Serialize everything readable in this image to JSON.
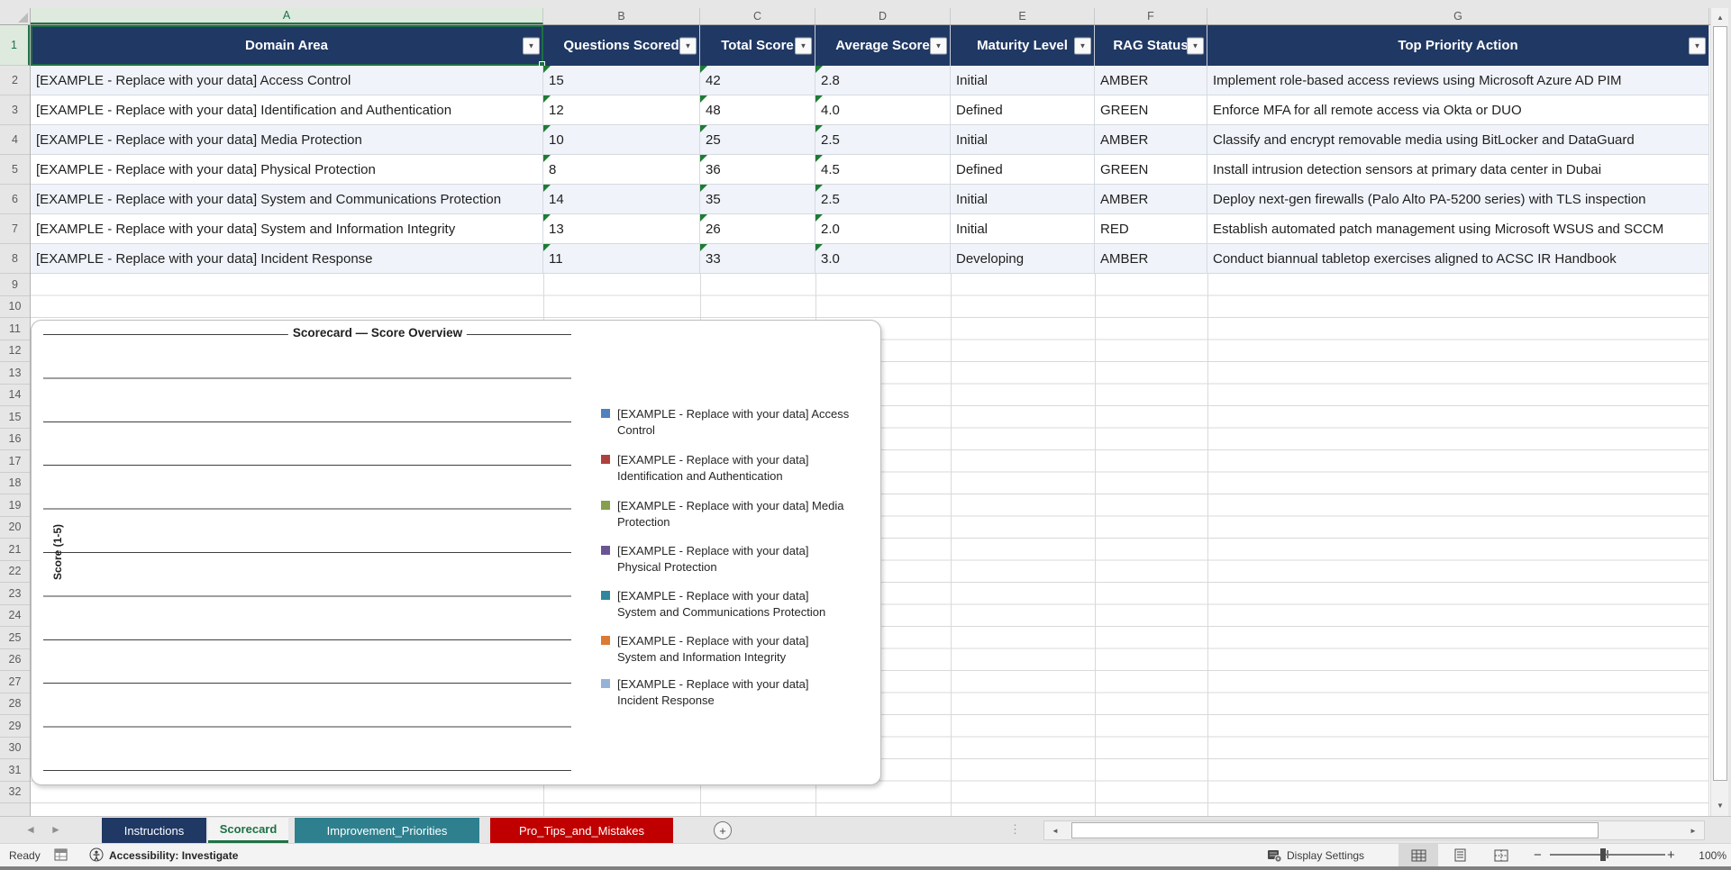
{
  "app": {
    "zoom_level": "100%"
  },
  "icons": {
    "filter": "▼",
    "scroll_up": "▲",
    "scroll_down": "▼",
    "scroll_left": "◄",
    "scroll_right": "►",
    "tab_prev": "◄",
    "tab_next": "►",
    "new_sheet": "+",
    "grip": "⋮",
    "zoom_out": "−",
    "zoom_in": "+"
  },
  "grid": {
    "column_letters": [
      "A",
      "B",
      "C",
      "D",
      "E",
      "F",
      "G"
    ],
    "row_count": 32,
    "selected_column": "A",
    "selected_row": "1"
  },
  "table": {
    "headers": [
      "Domain Area",
      "Questions Scored",
      "Total Score",
      "Average Score",
      "Maturity Level",
      "RAG Status",
      "Top Priority Action"
    ],
    "rows": [
      {
        "domain": "[EXAMPLE - Replace with your data] Access Control",
        "questions": "15",
        "total": "42",
        "average": "2.8",
        "maturity": "Initial",
        "rag": "AMBER",
        "action": "Implement role-based access reviews using Microsoft Azure AD PIM"
      },
      {
        "domain": "[EXAMPLE - Replace with your data] Identification and Authentication",
        "questions": "12",
        "total": "48",
        "average": "4.0",
        "maturity": "Defined",
        "rag": "GREEN",
        "action": "Enforce MFA for all remote access via Okta or DUO"
      },
      {
        "domain": "[EXAMPLE - Replace with your data] Media Protection",
        "questions": "10",
        "total": "25",
        "average": "2.5",
        "maturity": "Initial",
        "rag": "AMBER",
        "action": "Classify and encrypt removable media using BitLocker and DataGuard"
      },
      {
        "domain": "[EXAMPLE - Replace with your data] Physical Protection",
        "questions": "8",
        "total": "36",
        "average": "4.5",
        "maturity": "Defined",
        "rag": "GREEN",
        "action": "Install intrusion detection sensors at primary data center in Dubai"
      },
      {
        "domain": "[EXAMPLE - Replace with your data] System and Communications Protection",
        "questions": "14",
        "total": "35",
        "average": "2.5",
        "maturity": "Initial",
        "rag": "AMBER",
        "action": "Deploy next-gen firewalls (Palo Alto PA-5200 series) with TLS inspection"
      },
      {
        "domain": "[EXAMPLE - Replace with your data] System and Information Integrity",
        "questions": "13",
        "total": "26",
        "average": "2.0",
        "maturity": "Initial",
        "rag": "RED",
        "action": "Establish automated patch management using Microsoft WSUS and SCCM"
      },
      {
        "domain": "[EXAMPLE - Replace with your data] Incident Response",
        "questions": "11",
        "total": "33",
        "average": "3.0",
        "maturity": "Developing",
        "rag": "AMBER",
        "action": "Conduct biannual tabletop exercises aligned to ACSC IR Handbook"
      }
    ]
  },
  "chart_data": {
    "type": "bar",
    "title": "Scorecard — Score Overview",
    "ylabel": "Score (1-5)",
    "ylim": [
      0,
      5
    ],
    "gridline_count": 11,
    "grid": true,
    "legend_position": "right",
    "bars_visible": false,
    "categories": [
      "[EXAMPLE - Replace with your data] Access Control",
      "[EXAMPLE - Replace with your data] Identification and Authentication",
      "[EXAMPLE - Replace with your data] Media Protection",
      "[EXAMPLE - Replace with your data] Physical Protection",
      "[EXAMPLE - Replace with your data] System and Communications Protection",
      "[EXAMPLE - Replace with your data] System and Information Integrity",
      "[EXAMPLE - Replace with your data] Incident Response"
    ],
    "legend": [
      {
        "color": "#4F81BD",
        "lines": [
          "[EXAMPLE - Replace with your data] Access",
          "Control"
        ]
      },
      {
        "color": "#AE413E",
        "lines": [
          "[EXAMPLE - Replace with your data]",
          "Identification and Authentication"
        ]
      },
      {
        "color": "#84A04C",
        "lines": [
          "[EXAMPLE - Replace with your data] Media",
          "Protection"
        ]
      },
      {
        "color": "#6B5494",
        "lines": [
          "[EXAMPLE - Replace with your data]",
          "Physical Protection"
        ]
      },
      {
        "color": "#31859C",
        "lines": [
          "[EXAMPLE - Replace with your data]",
          "System and Communications Protection"
        ]
      },
      {
        "color": "#DB7A33",
        "lines": [
          "[EXAMPLE - Replace with your data]",
          "System and Information Integrity"
        ]
      },
      {
        "color": "#95B3D7",
        "lines": [
          "[EXAMPLE - Replace with your data]",
          "Incident Response"
        ]
      }
    ]
  },
  "sheet_tabs": {
    "items": [
      {
        "label": "Instructions",
        "color": "#1F3864",
        "active": false
      },
      {
        "label": "Scorecard",
        "color": "#F3F3F3",
        "active": true
      },
      {
        "label": "Improvement_Priorities",
        "color": "#2E808F",
        "active": false
      },
      {
        "label": "Pro_Tips_and_Mistakes",
        "color": "#C00000",
        "active": false
      }
    ]
  },
  "status_bar": {
    "mode": "Ready",
    "accessibility": "Accessibility: Investigate",
    "display_settings": "Display Settings",
    "zoom_value": "100%"
  },
  "colors": {
    "header_fill": "#203864",
    "selection_green": "#1D7044",
    "active_tab_green": "#1E7145",
    "error_marker_green": "#1E7B34"
  }
}
